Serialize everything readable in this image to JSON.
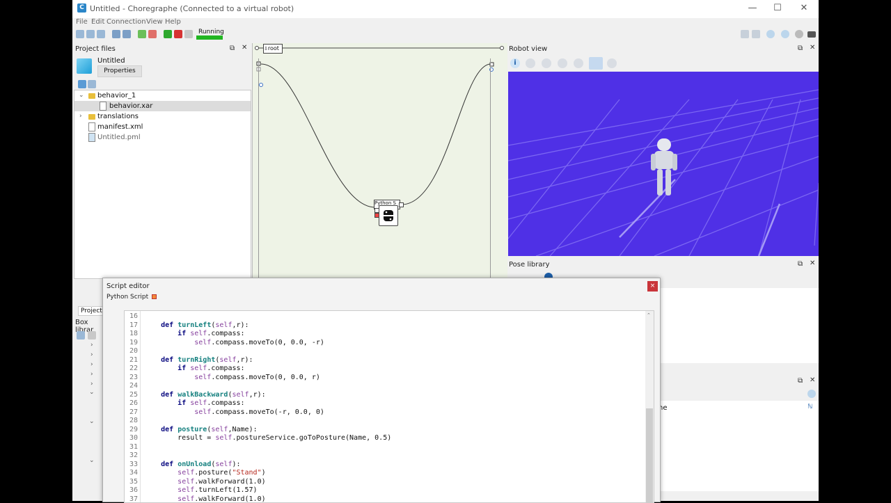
{
  "window": {
    "title": "Untitled - Choregraphe (Connected to a virtual robot)",
    "app_icon_letter": "C",
    "minimize": "—",
    "maximize": "☐",
    "close": "✕"
  },
  "menu": [
    "File",
    "Edit",
    "Connection",
    "View",
    "Help"
  ],
  "toolbar": {
    "status_label": "Running",
    "status_color": "#22b622"
  },
  "project_files": {
    "title": "Project files",
    "project_name": "Untitled",
    "properties_button": "Properties",
    "tree": [
      {
        "label": "behavior_1",
        "type": "folder",
        "expanded": true
      },
      {
        "label": "behavior.xar",
        "type": "file",
        "selected": true
      },
      {
        "label": "translations",
        "type": "folder",
        "expanded": false
      },
      {
        "label": "manifest.xml",
        "type": "file"
      },
      {
        "label": "Untitled.pml",
        "type": "file"
      }
    ],
    "bottom_tab": "Project f"
  },
  "box_library": {
    "title": "Box librar"
  },
  "flow_diagram": {
    "breadcrumb_root": "root",
    "box_label": "Python S"
  },
  "robot_view": {
    "title": "Robot view",
    "background": "#4f30e6"
  },
  "pose_library": {
    "title": "Pose library"
  },
  "side_panel": {
    "partial_text": "ne"
  },
  "script_editor": {
    "title": "Script editor",
    "close": "×",
    "tab_label": "Python Script",
    "line_numbers": [
      "16",
      "17",
      "18",
      "19",
      "20",
      "21",
      "22",
      "23",
      "24",
      "25",
      "26",
      "27",
      "28",
      "29",
      "30",
      "31",
      "32",
      "33",
      "34",
      "35",
      "36",
      "37"
    ],
    "lines": [
      "",
      "    def turnLeft(self,r):",
      "        if self.compass:",
      "            self.compass.moveTo(0, 0.0, -r)",
      "",
      "    def turnRight(self,r):",
      "        if self.compass:",
      "            self.compass.moveTo(0, 0.0, r)",
      "",
      "    def walkBackward(self,r):",
      "        if self.compass:",
      "            self.compass.moveTo(-r, 0.0, 0)",
      "",
      "    def posture(self,Name):",
      "        result = self.postureService.goToPosture(Name, 0.5)",
      "",
      "",
      "    def onUnload(self):",
      "        self.posture(\"Stand\")",
      "        self.walkForward(1.0)",
      "        self.turnLeft(1.57)",
      "        self.walkForward(1.0)"
    ]
  }
}
